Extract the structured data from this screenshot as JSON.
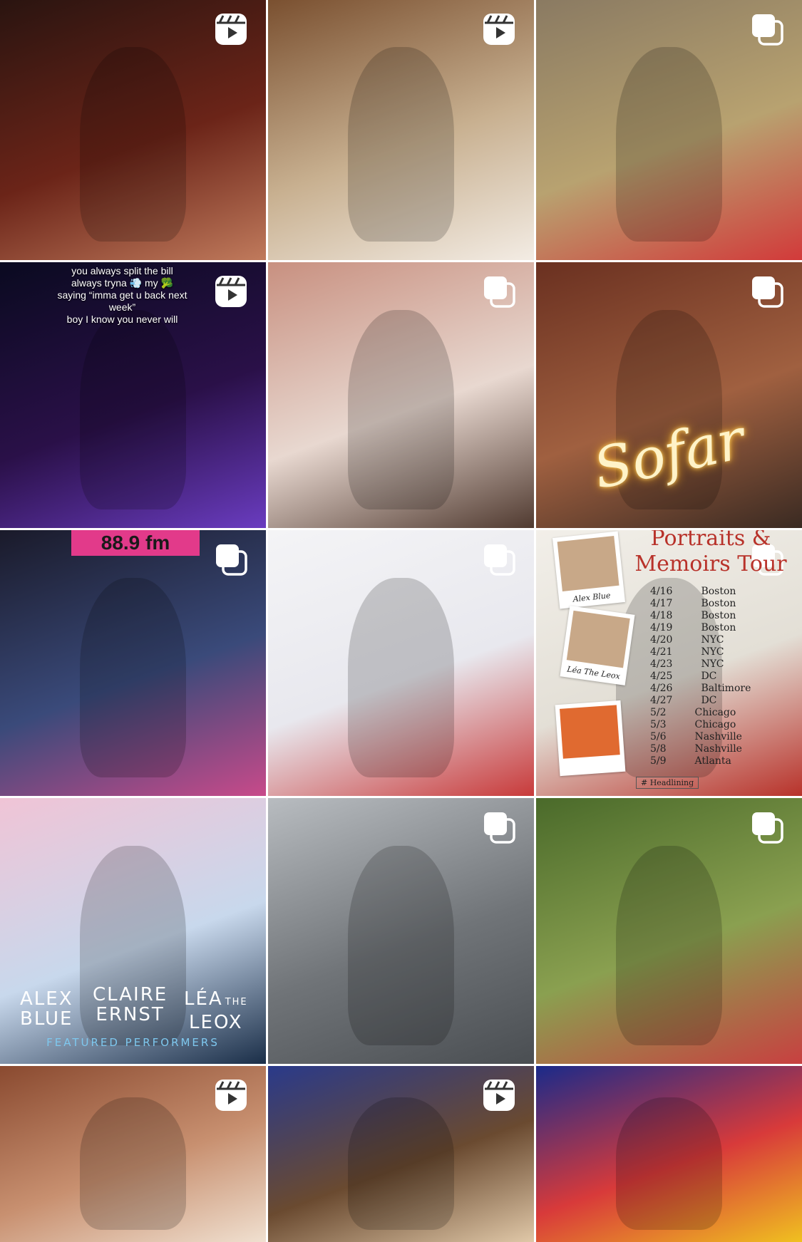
{
  "profile_grid": {
    "tiles": [
      {
        "id": "singing-mic",
        "type": "reel",
        "colors": [
          "#2a1410",
          "#6b2418",
          "#c07a5c"
        ]
      },
      {
        "id": "piano-selfie",
        "type": "reel",
        "colors": [
          "#7a5030",
          "#c8b090",
          "#f3ece4"
        ]
      },
      {
        "id": "flowers-theater",
        "type": "carousel",
        "colors": [
          "#8a7a62",
          "#b8a270",
          "#d23a3a"
        ]
      },
      {
        "id": "trio-stage",
        "type": "reel",
        "colors": [
          "#0a0a20",
          "#2a1048",
          "#6a3cc0"
        ],
        "caption": [
          "you always split the bill",
          "always tryna 💨 my 🥦",
          "saying “imma get u back next",
          "week”",
          "boy I know you never will"
        ]
      },
      {
        "id": "hallway-mirror",
        "type": "carousel",
        "colors": [
          "#c89080",
          "#e8d8d0",
          "#503a30"
        ]
      },
      {
        "id": "sofar-brick",
        "type": "carousel",
        "colors": [
          "#6a3020",
          "#a06040",
          "#3a2a22"
        ],
        "sign": "Sofar"
      },
      {
        "id": "radio-studio",
        "type": "carousel",
        "colors": [
          "#1a1a2a",
          "#3a4a7a",
          "#c84a8a"
        ],
        "station": "88.9 fm"
      },
      {
        "id": "polka-dot-skirt",
        "type": "carousel",
        "colors": [
          "#f4f4f6",
          "#e8e8ee",
          "#c83a3a"
        ]
      },
      {
        "id": "tour-poster",
        "type": "carousel",
        "colors": [
          "#f2efe9",
          "#e3dfd6",
          "#b8322a"
        ],
        "poster": {
          "title_line1": "Portraits &",
          "title_line2": "Memoirs Tour",
          "names": [
            "Alex Blue",
            "Léa The Leox"
          ],
          "dates": [
            {
              "d": "4/16",
              "c": "Boston"
            },
            {
              "d": "4/17",
              "c": "Boston"
            },
            {
              "d": "4/18",
              "c": "Boston"
            },
            {
              "d": "4/19",
              "c": "Boston"
            },
            {
              "d": "4/20",
              "c": "NYC"
            },
            {
              "d": "4/21",
              "c": "NYC"
            },
            {
              "d": "4/23",
              "c": "NYC"
            },
            {
              "d": "4/25",
              "c": "DC"
            },
            {
              "d": "4/26",
              "c": "Baltimore"
            },
            {
              "d": "4/27",
              "c": "DC"
            },
            {
              "d": "5/2",
              "c": "Chicago"
            },
            {
              "d": "5/3",
              "c": "Chicago"
            },
            {
              "d": "5/6",
              "c": "Nashville"
            },
            {
              "d": "5/8",
              "c": "Nashville"
            },
            {
              "d": "5/9",
              "c": "Atlanta"
            }
          ],
          "legend": "# Headlining"
        }
      },
      {
        "id": "featured-performers",
        "type": "image",
        "colors": [
          "#f0c4d6",
          "#c8d8ec",
          "#1a2e48"
        ],
        "performers": [
          {
            "line1": "ALEX",
            "line2": "BLUE"
          },
          {
            "line1": "CLAIRE",
            "line2": "ERNST"
          },
          {
            "line1": "LÉA",
            "line1b": "THE",
            "line2": "LEOX"
          }
        ],
        "footer": "FEATURED PERFORMERS"
      },
      {
        "id": "parking-lot",
        "type": "carousel",
        "colors": [
          "#b8bcc0",
          "#707478",
          "#4a4e52"
        ]
      },
      {
        "id": "picnic",
        "type": "carousel",
        "colors": [
          "#4a6a2a",
          "#8aa050",
          "#c84040"
        ]
      },
      {
        "id": "red-lips",
        "type": "reel",
        "colors": [
          "#8a4a30",
          "#c89070",
          "#f0e0d0"
        ]
      },
      {
        "id": "sunglasses",
        "type": "reel",
        "colors": [
          "#2a3a8a",
          "#6a4a30",
          "#e0c8a8"
        ]
      },
      {
        "id": "colorful-sweater",
        "type": "image",
        "colors": [
          "#1a2a8a",
          "#d83a3a",
          "#f0c020"
        ]
      }
    ]
  }
}
